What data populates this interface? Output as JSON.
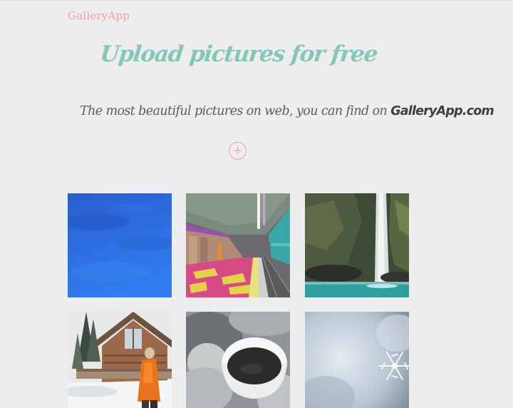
{
  "header": {
    "brand": "GalleryApp"
  },
  "hero": {
    "title": "Upload pictures for free",
    "subtitle_prefix": "The most beautiful pictures on web, you can find on",
    "subtitle_site": "GalleryApp.com"
  },
  "upload_button": {
    "label": "+"
  },
  "gallery": {
    "photos": [
      {
        "subject": "blue sky"
      },
      {
        "subject": "subway station platform"
      },
      {
        "subject": "waterfall"
      },
      {
        "subject": "woman in orange jacket by wooden cabin in snow"
      },
      {
        "subject": "coffee cup held in knitted mittens"
      },
      {
        "subject": "snowflake"
      }
    ]
  },
  "colors": {
    "background": "#ededed",
    "brand": "#f0a3a0",
    "title": "#84c7b8",
    "subtitle": "#5c5c5c"
  }
}
